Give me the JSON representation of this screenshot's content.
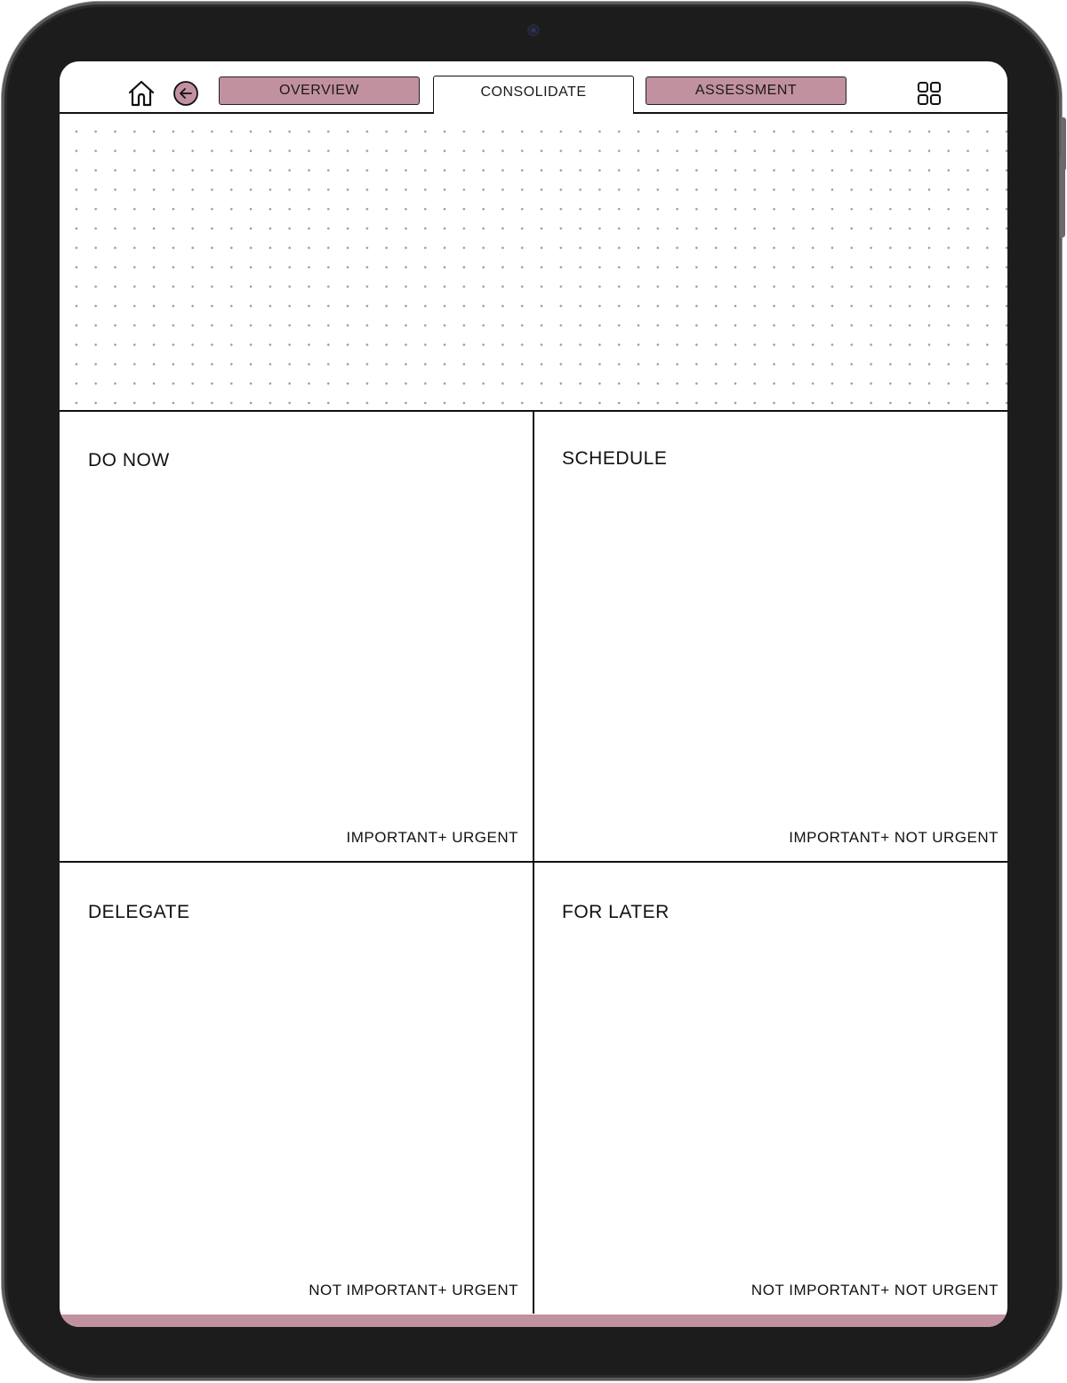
{
  "nav": {
    "home_icon": "home-icon",
    "back_icon": "arrow-left-circle-icon",
    "tabs": [
      {
        "label": "OVERVIEW",
        "active": false
      },
      {
        "label": "CONSOLIDATE",
        "active": true
      },
      {
        "label": "ASSESSMENT",
        "active": false
      }
    ],
    "grid_icon": "grid-icon"
  },
  "quadrants": [
    {
      "title": "DO NOW",
      "subtitle": "IMPORTANT+ URGENT"
    },
    {
      "title": "SCHEDULE",
      "subtitle": "IMPORTANT+ NOT URGENT"
    },
    {
      "title": "DELEGATE",
      "subtitle": "NOT IMPORTANT+ URGENT"
    },
    {
      "title": "FOR LATER",
      "subtitle": "NOT IMPORTANT+ NOT URGENT"
    }
  ],
  "colors": {
    "accent": "#c291a0",
    "device_frame": "#1c1c1c",
    "line": "#111111"
  }
}
